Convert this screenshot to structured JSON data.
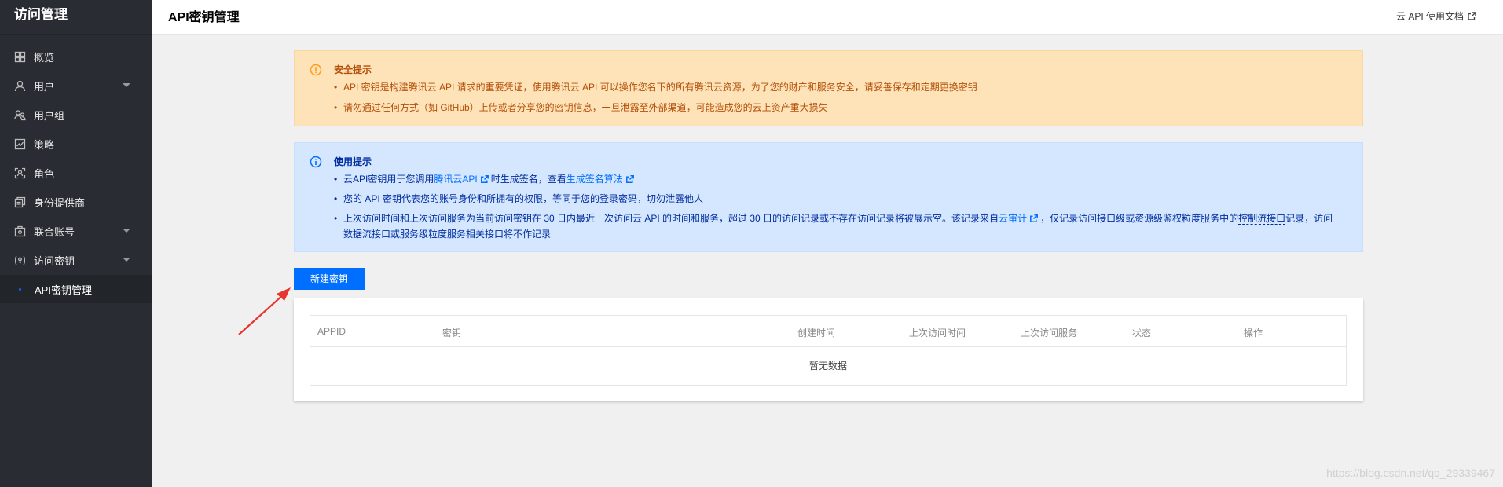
{
  "sidebar": {
    "title": "访问管理",
    "items": [
      {
        "label": "概览",
        "icon": "overview-icon",
        "has_caret": false
      },
      {
        "label": "用户",
        "icon": "user-icon",
        "has_caret": true
      },
      {
        "label": "用户组",
        "icon": "user-group-icon",
        "has_caret": false
      },
      {
        "label": "策略",
        "icon": "policy-icon",
        "has_caret": false
      },
      {
        "label": "角色",
        "icon": "role-icon",
        "has_caret": false
      },
      {
        "label": "身份提供商",
        "icon": "identity-provider-icon",
        "has_caret": false
      },
      {
        "label": "联合账号",
        "icon": "federated-account-icon",
        "has_caret": true
      },
      {
        "label": "访问密钥",
        "icon": "access-key-icon",
        "has_caret": true
      }
    ],
    "sub_items": [
      {
        "label": "API密钥管理",
        "active": true
      }
    ]
  },
  "header": {
    "title": "API密钥管理",
    "doc_link": "云 API 使用文档"
  },
  "security_alert": {
    "title": "安全提示",
    "items": [
      "API 密钥是构建腾讯云 API 请求的重要凭证，使用腾讯云 API 可以操作您名下的所有腾讯云资源，为了您的财产和服务安全，请妥善保存和定期更换密钥",
      "请勿通过任何方式（如 GitHub）上传或者分享您的密钥信息，一旦泄露至外部渠道，可能造成您的云上资产重大损失"
    ]
  },
  "usage_alert": {
    "title": "使用提示",
    "item1": {
      "pre": "云API密钥用于您调用",
      "link1": "腾讯云API",
      "mid": "时生成签名，查看",
      "link2": "生成签名算法"
    },
    "item2": "您的 API 密钥代表您的账号身份和所拥有的权限，等同于您的登录密码，切勿泄露他人",
    "item3": {
      "pre": "上次访问时间和上次访问服务为当前访问密钥在 30 日内最近一次访问云 API 的时间和服务，超过 30 日的访问记录或不存在访问记录将被展示空。该记录来自",
      "link": "云审计",
      "mid1": "，仅记录访问接口级或资源级鉴权粒度服务中的",
      "dashed1": "控制流接口",
      "mid2": "记录，访问",
      "dashed2": "数据流接口",
      "post": "或服务级粒度服务相关接口将不作记录"
    }
  },
  "new_key_button": "新建密钥",
  "table": {
    "columns": [
      "APPID",
      "密钥",
      "创建时间",
      "上次访问时间",
      "上次访问服务",
      "状态",
      "操作"
    ],
    "empty_text": "暂无数据"
  },
  "watermark": "https://blog.csdn.net/qq_29339467",
  "colors": {
    "sidebar_bg": "#292d33",
    "primary": "#006eff",
    "warn_bg": "#fde3b7",
    "warn_text": "#b44e09",
    "info_bg": "#d5e7fe",
    "info_text": "#002da0",
    "annotation_arrow": "#e8352f"
  }
}
